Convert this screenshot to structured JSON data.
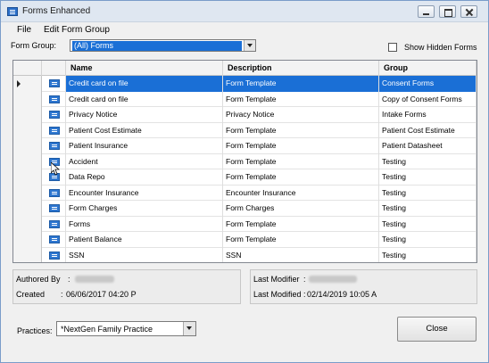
{
  "window": {
    "title": "Forms Enhanced",
    "controls": [
      "minimize",
      "maximize",
      "close"
    ]
  },
  "menu": {
    "file": "File",
    "edit_form_group": "Edit Form Group"
  },
  "filters": {
    "form_group_label": "Form Group:",
    "form_group_value": "(All) Forms",
    "show_hidden_label": "Show Hidden Forms",
    "show_hidden_checked": false
  },
  "grid": {
    "columns": [
      "Name",
      "Description",
      "Group"
    ],
    "rows": [
      {
        "name": "Credit card on file",
        "description": "Form Template",
        "group": "Consent Forms",
        "selected": true
      },
      {
        "name": "Credit card on file",
        "description": "Form Template",
        "group": "Copy of Consent Forms"
      },
      {
        "name": "Privacy Notice",
        "description": "Privacy Notice",
        "group": "Intake Forms"
      },
      {
        "name": "Patient Cost Estimate",
        "description": "Form Template",
        "group": "Patient Cost Estimate"
      },
      {
        "name": "Patient Insurance",
        "description": "Form Template",
        "group": "Patient Datasheet"
      },
      {
        "name": "Accident",
        "description": "Form Template",
        "group": "Testing"
      },
      {
        "name": "Data Repo",
        "description": "Form Template",
        "group": "Testing"
      },
      {
        "name": "Encounter Insurance",
        "description": "Encounter Insurance",
        "group": "Testing"
      },
      {
        "name": "Form Charges",
        "description": "Form Charges",
        "group": "Testing"
      },
      {
        "name": "Forms",
        "description": "Form Template",
        "group": "Testing"
      },
      {
        "name": "Patient Balance",
        "description": "Form Template",
        "group": "Testing"
      },
      {
        "name": "SSN",
        "description": "SSN",
        "group": "Testing"
      }
    ]
  },
  "info": {
    "authored_by_label": "Authored By",
    "created_label": "Created",
    "created_value": "06/06/2017 04:20 P",
    "last_modifier_label": "Last Modifier",
    "last_modified_label": "Last Modified",
    "last_modified_value": "02/14/2019 10:05 A"
  },
  "footer": {
    "practices_label": "Practices:",
    "practices_value": "*NextGen Family Practice",
    "close_label": "Close"
  },
  "colors": {
    "selection": "#1a6fd6",
    "title_bar": "#dfe7f1"
  }
}
